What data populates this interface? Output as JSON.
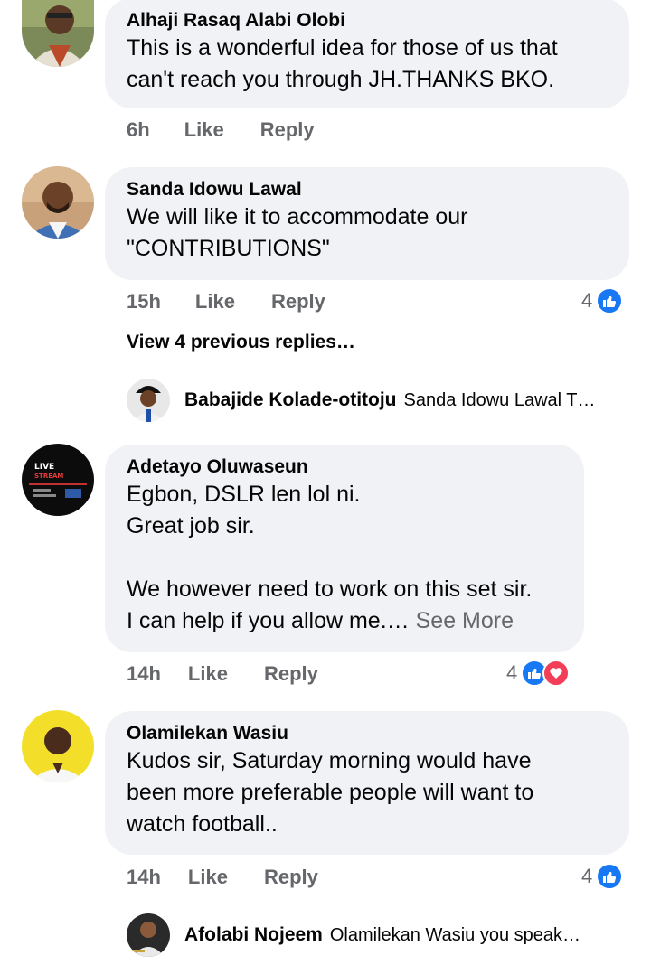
{
  "comments": [
    {
      "author": "Alhaji Rasaq Alabi Olobi",
      "lines": [
        "This is a wonderful idea for those of us that",
        "can't reach you through JH.THANKS BKO."
      ],
      "time": "6h",
      "like_label": "Like",
      "reply_label": "Reply"
    },
    {
      "author": "Sanda Idowu Lawal",
      "lines": [
        "We will like it to accommodate our",
        "\"CONTRIBUTIONS\""
      ],
      "time": "15h",
      "like_label": "Like",
      "reply_label": "Reply",
      "reaction_count": "4",
      "view_replies": "View 4 previous replies…",
      "reply": {
        "author": "Babajide Kolade-otitoju",
        "snippet": "Sanda Idowu Lawal T…"
      }
    },
    {
      "author": "Adetayo Oluwaseun",
      "lines": [
        "Egbon, DSLR len lol ni.",
        "Great job sir.",
        "",
        "We however need to work on this set sir.",
        "I can help if you allow me.…"
      ],
      "see_more": "See More",
      "time": "14h",
      "like_label": "Like",
      "reply_label": "Reply",
      "reaction_count": "4",
      "avatar_text": {
        "line1": "LIVE",
        "line2": "STREAM"
      }
    },
    {
      "author": "Olamilekan Wasiu",
      "lines": [
        "Kudos  sir, Saturday morning would have",
        "been more preferable people will want to",
        "watch football.."
      ],
      "time": "14h",
      "like_label": "Like",
      "reply_label": "Reply",
      "reaction_count": "4",
      "reply": {
        "author": "Afolabi Nojeem",
        "snippet": "Olamilekan Wasiu you speak…"
      }
    }
  ],
  "colors": {
    "bubble": "#f0f2f5",
    "meta": "#65676b",
    "like": "#1877f2",
    "love": "#f33e58"
  }
}
